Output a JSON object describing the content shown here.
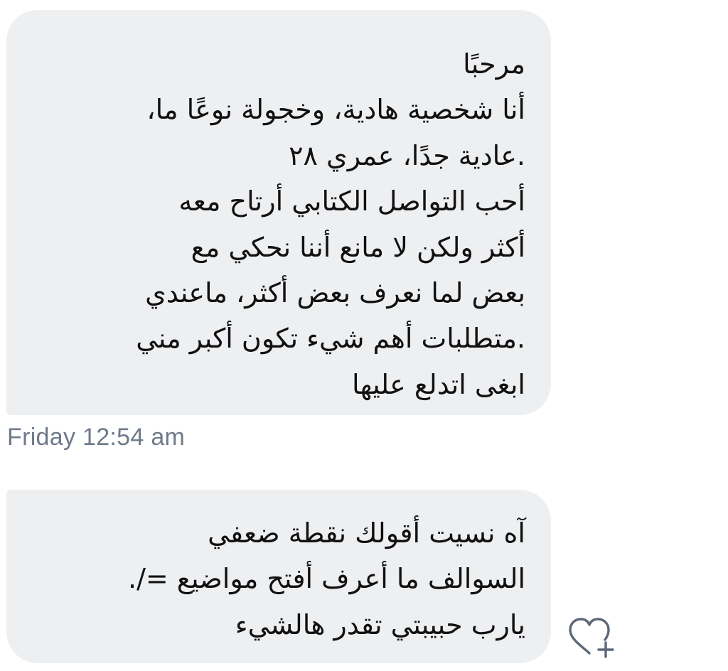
{
  "messages": [
    {
      "lines": [
        "مرحبًا",
        "أنا شخصية هادية، وخجولة نوعًا ما،",
        ".عادية جدًا، عمري ٢٨",
        "أحب التواصل الكتابي أرتاح معه",
        "أكثر ولكن لا مانع أننا نحكي مع",
        "بعض لما نعرف بعض أكثر، ماعندي",
        ".متطلبات أهم شيء تكون أكبر مني",
        "ابغى اتدلع عليها"
      ]
    },
    {
      "lines": [
        "آه نسيت أقولك نقطة ضعفي",
        "السوالف ما أعرف أفتح مواضيع =/.",
        "يارب حبيبتي تقدر هالشيء"
      ]
    }
  ],
  "timestamp": "Friday 12:54 am",
  "reaction_button": {
    "icon": "heart-plus-icon"
  },
  "colors": {
    "bubble": "#eeeff1",
    "text": "#111111",
    "timestamp": "#6e7a8a",
    "icon": "#5d6877"
  }
}
